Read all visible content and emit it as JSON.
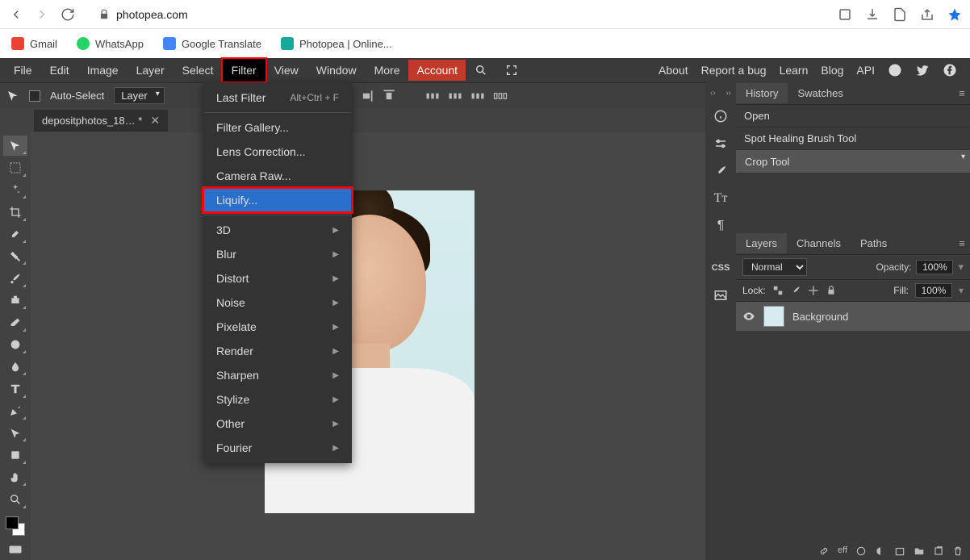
{
  "browser": {
    "url": "photopea.com",
    "bookmarks": [
      {
        "label": "Gmail",
        "color": "#ea4335"
      },
      {
        "label": "WhatsApp",
        "color": "#25d366"
      },
      {
        "label": "Google Translate",
        "color": "#4285f4"
      },
      {
        "label": "Photopea | Online...",
        "color": "#15a89b"
      }
    ]
  },
  "menubar": {
    "items": [
      "File",
      "Edit",
      "Image",
      "Layer",
      "Select",
      "Filter",
      "View",
      "Window",
      "More"
    ],
    "open_index": 5,
    "account": "Account",
    "right": [
      "About",
      "Report a bug",
      "Learn",
      "Blog",
      "API"
    ]
  },
  "optbar": {
    "auto_select": "Auto-Select",
    "layer_select": "Layer"
  },
  "doc_tab": {
    "title": "depositphotos_18… *"
  },
  "filter_menu": {
    "last_filter": {
      "label": "Last Filter",
      "shortcut": "Alt+Ctrl + F"
    },
    "items_a": [
      "Filter Gallery...",
      "Lens Correction...",
      "Camera Raw..."
    ],
    "highlight": "Liquify...",
    "items_b": [
      "3D",
      "Blur",
      "Distort",
      "Noise",
      "Pixelate",
      "Render",
      "Sharpen",
      "Stylize",
      "Other",
      "Fourier"
    ]
  },
  "history": {
    "tabs": [
      "History",
      "Swatches"
    ],
    "items": [
      "Open",
      "Spot Healing Brush Tool",
      "Crop Tool"
    ]
  },
  "layers": {
    "tabs": [
      "Layers",
      "Channels",
      "Paths"
    ],
    "blend_mode": "Normal",
    "opacity_label": "Opacity:",
    "opacity_val": "100%",
    "lock_label": "Lock:",
    "fill_label": "Fill:",
    "fill_val": "100%",
    "layer_name": "Background"
  },
  "strip_css": "CSS",
  "bottombar_eff": "eff"
}
